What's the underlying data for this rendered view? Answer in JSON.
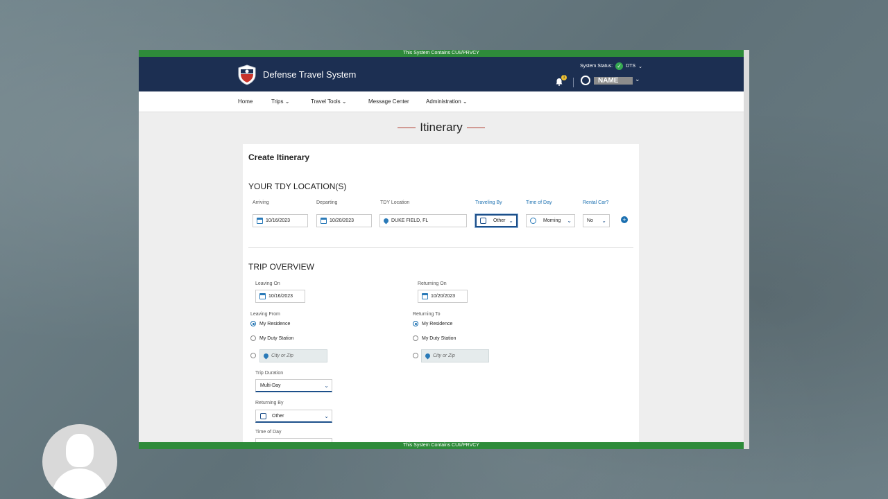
{
  "banner": {
    "cui_text": "This System Contains CUI//PRVCY"
  },
  "header": {
    "app_title": "Defense Travel System",
    "system_status_label": "System Status:",
    "system_status_value": "DTS",
    "notification_count": "1",
    "user_name": "NAME"
  },
  "nav": {
    "items": [
      {
        "label": "Home",
        "has_dropdown": false
      },
      {
        "label": "Trips",
        "has_dropdown": true
      },
      {
        "label": "Travel Tools",
        "has_dropdown": true
      },
      {
        "label": "Message Center",
        "has_dropdown": false
      },
      {
        "label": "Administration",
        "has_dropdown": true
      }
    ]
  },
  "page": {
    "title": "Itinerary"
  },
  "card": {
    "title": "Create Itinerary",
    "tdy": {
      "heading": "YOUR TDY LOCATION(S)",
      "arriving_label": "Arriving",
      "arriving_value": "10/16/2023",
      "departing_label": "Departing",
      "departing_value": "10/20/2023",
      "location_label": "TDY Location",
      "location_value": "DUKE FIELD, FL",
      "traveling_by_label": "Traveling By",
      "traveling_by_value": "Other",
      "time_of_day_label": "Time of Day",
      "time_of_day_value": "Morning",
      "rental_car_label": "Rental Car?",
      "rental_car_value": "No"
    },
    "overview": {
      "heading": "TRIP OVERVIEW",
      "leaving_on_label": "Leaving On",
      "leaving_on_value": "10/16/2023",
      "returning_on_label": "Returning On",
      "returning_on_value": "10/20/2023",
      "leaving_from_label": "Leaving From",
      "returning_to_label": "Returning To",
      "opt_residence": "My Residence",
      "opt_duty_station": "My Duty Station",
      "city_zip_placeholder": "City or Zip",
      "trip_duration_label": "Trip Duration",
      "trip_duration_value": "Multi-Day",
      "returning_by_label": "Returning By",
      "returning_by_value": "Other",
      "time_of_day_label": "Time of Day"
    }
  },
  "colors": {
    "header_bg": "#1c2f52",
    "cui_green": "#2e8b3a",
    "accent_blue": "#1a6fb0",
    "title_dash": "#b03a2e"
  }
}
